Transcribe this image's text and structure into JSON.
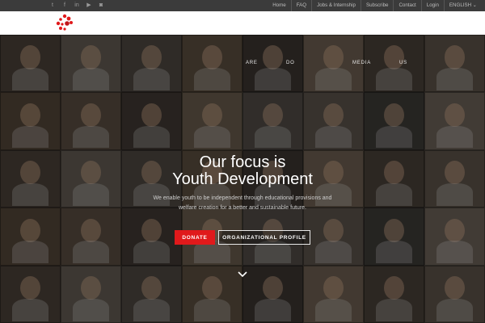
{
  "social": {
    "icons": [
      "twitter-icon",
      "facebook-icon",
      "linkedin-icon",
      "youtube-icon",
      "instagram-icon"
    ],
    "glyphs": [
      "t",
      "f",
      "in",
      "▶",
      "◙"
    ]
  },
  "topnav": {
    "items": [
      "Home",
      "FAQ",
      "Jobs & Internship",
      "Subscribe",
      "Contact",
      "Login"
    ],
    "language": "ENGLISH ⌄"
  },
  "heronav": {
    "items": [
      "ARE",
      "DO",
      "MEDIA",
      "US"
    ]
  },
  "hero": {
    "title_line1": "Our focus is",
    "title_line2": "Youth Development",
    "subtitle": "We enable youth to be independent through educational provisions and welfare creation for a better and sustainable future.",
    "donate_label": "DONATE",
    "profile_label": "ORGANIZATIONAL PROFILE"
  },
  "colors": {
    "accent_red": "#e0191b",
    "topbar": "#3b3b3b",
    "header": "#ffffff"
  }
}
